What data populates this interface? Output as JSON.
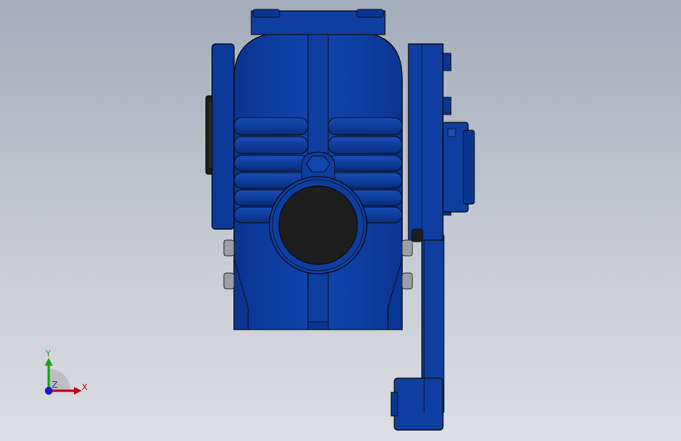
{
  "viewport": {
    "background_top": "#a3adba",
    "background_bottom": "#dcdfe3"
  },
  "model": {
    "name": "worm-gear-reducer",
    "body_color": "#0e3fa0",
    "body_shadow": "#082a70",
    "edge_color": "#0a0a14",
    "bore_color": "#1e1e1e",
    "bolt_color": "#9aa0a6"
  },
  "triad": {
    "x_label": "X",
    "y_label": "Y",
    "z_label": "Z",
    "x_color": "#c0001a",
    "y_color": "#18a018",
    "z_color": "#1a1ad0"
  }
}
